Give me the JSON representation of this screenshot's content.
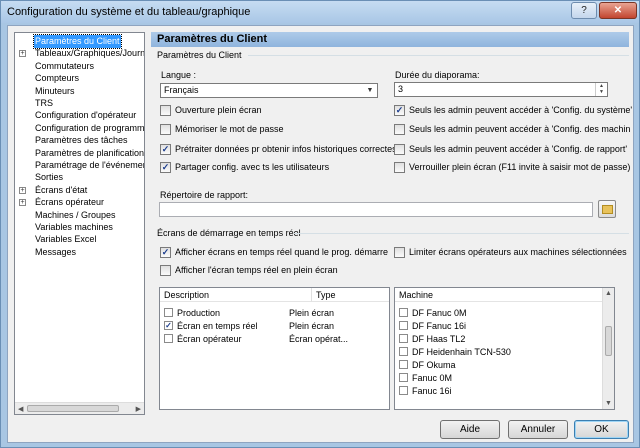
{
  "window": {
    "title": "Configuration du système et du tableau/graphique",
    "help_label": "?",
    "close_label": "✕"
  },
  "tree": {
    "items": [
      {
        "label": "Paramètres du Client",
        "expandable": false,
        "selected": true
      },
      {
        "label": "Tableaux/Graphiques/Journa",
        "expandable": true,
        "selected": false
      },
      {
        "label": "Commutateurs",
        "expandable": false,
        "selected": false
      },
      {
        "label": "Compteurs",
        "expandable": false,
        "selected": false
      },
      {
        "label": "Minuteurs",
        "expandable": false,
        "selected": false
      },
      {
        "label": "TRS",
        "expandable": false,
        "selected": false
      },
      {
        "label": "Configuration d'opérateur",
        "expandable": false,
        "selected": false
      },
      {
        "label": "Configuration de programme",
        "expandable": false,
        "selected": false
      },
      {
        "label": "Paramètres des tâches",
        "expandable": false,
        "selected": false
      },
      {
        "label": "Paramètres de planification",
        "expandable": false,
        "selected": false
      },
      {
        "label": "Paramétrage de l'événement",
        "expandable": false,
        "selected": false
      },
      {
        "label": "Sorties",
        "expandable": false,
        "selected": false
      },
      {
        "label": "Écrans d'état",
        "expandable": true,
        "selected": false
      },
      {
        "label": "Écrans opérateur",
        "expandable": true,
        "selected": false
      },
      {
        "label": "Machines / Groupes",
        "expandable": false,
        "selected": false
      },
      {
        "label": "Variables machines",
        "expandable": false,
        "selected": false
      },
      {
        "label": "Variables Excel",
        "expandable": false,
        "selected": false
      },
      {
        "label": "Messages",
        "expandable": false,
        "selected": false
      }
    ],
    "expander_symbol": "+"
  },
  "panel": {
    "header": "Paramètres du Client",
    "client_group": {
      "title": "Paramètres du Client",
      "language_label": "Langue :",
      "language_value": "Français",
      "slideshow_label": "Durée du diaporama:",
      "slideshow_value": "3"
    },
    "left_checks": [
      {
        "label": "Ouverture plein écran",
        "checked": false
      },
      {
        "label": "Mémoriser le mot de passe",
        "checked": false
      },
      {
        "label": "Prétraiter données pr obtenir infos historiques correctes",
        "checked": true
      },
      {
        "label": "Partager config. avec ts les utilisateurs",
        "checked": true
      }
    ],
    "right_checks": [
      {
        "label": "Seuls les admin peuvent accéder à 'Config. du système'",
        "checked": true
      },
      {
        "label": "Seuls les admin peuvent accéder à 'Config. des machin",
        "checked": false
      },
      {
        "label": "Seuls les admin peuvent accéder à 'Config. de rapport'",
        "checked": false
      },
      {
        "label": "Verrouiller plein écran (F11 invite à saisir mot de passe)",
        "checked": false
      }
    ],
    "report_dir_label": "Répertoire de rapport:",
    "report_dir_value": "",
    "realtime_group": {
      "title": "Écrans de démarrage en temps réel",
      "check_start": {
        "label": "Afficher écrans en temps réel quand le prog. démarre",
        "checked": true
      },
      "check_fullscreen": {
        "label": "Afficher l'écran temps réel en plein écran",
        "checked": false
      },
      "check_limit": {
        "label": "Limiter écrans opérateurs aux machines sélectionnées",
        "checked": false
      },
      "screens_columns": [
        "Description",
        "Type"
      ],
      "screens": [
        {
          "description": "Production",
          "type": "Plein écran",
          "checked": false
        },
        {
          "description": "Écran en temps réel",
          "type": "Plein écran",
          "checked": true
        },
        {
          "description": "Écran opérateur",
          "type": "Écran opérat...",
          "checked": false
        }
      ],
      "machine_column": "Machine",
      "machines": [
        {
          "name": "DF Fanuc 0M",
          "checked": false
        },
        {
          "name": "DF Fanuc 16i",
          "checked": false
        },
        {
          "name": "DF Haas TL2",
          "checked": false
        },
        {
          "name": "DF Heidenhain TCN-530",
          "checked": false
        },
        {
          "name": "DF Okuma",
          "checked": false
        },
        {
          "name": "Fanuc 0M",
          "checked": false
        },
        {
          "name": "Fanuc 16i",
          "checked": false
        }
      ]
    }
  },
  "buttons": {
    "help": "Aide",
    "cancel": "Annuler",
    "ok": "OK"
  },
  "symbols": {
    "check": "✓",
    "dropdown": "▼",
    "up": "▲",
    "down": "▼",
    "left": "◀",
    "right": "▶"
  },
  "colors": {
    "selection": "#3399ff",
    "title_gradient_top": "#c6dcf2",
    "panel_header": "#aecbe9"
  }
}
